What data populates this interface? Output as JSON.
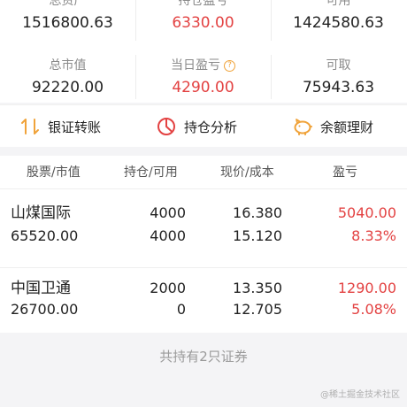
{
  "summary": {
    "total_assets": {
      "label": "总资产",
      "value": "1516800.63"
    },
    "position_pnl": {
      "label": "持仓盈亏",
      "value": "6330.00"
    },
    "available": {
      "label": "可用",
      "value": "1424580.63"
    },
    "market_value": {
      "label": "总市值",
      "value": "92220.00"
    },
    "daily_pnl": {
      "label": "当日盈亏",
      "value": "4290.00"
    },
    "withdrawable": {
      "label": "可取",
      "value": "75943.63"
    }
  },
  "actions": [
    {
      "label": "银证转账",
      "icon": "transfer-icon"
    },
    {
      "label": "持仓分析",
      "icon": "pie-chart-icon"
    },
    {
      "label": "余额理财",
      "icon": "piggy-bank-icon"
    }
  ],
  "holdings_header": {
    "col1": "股票/市值",
    "col2": "持仓/可用",
    "col3": "现价/成本",
    "col4": "盈亏"
  },
  "holdings": [
    {
      "name": "山煤国际",
      "market_value": "65520.00",
      "position": "4000",
      "available": "4000",
      "price": "16.380",
      "cost": "15.120",
      "pnl": "5040.00",
      "pnl_pct": "8.33%"
    },
    {
      "name": "中国卫通",
      "market_value": "26700.00",
      "position": "2000",
      "available": "0",
      "price": "13.350",
      "cost": "12.705",
      "pnl": "1290.00",
      "pnl_pct": "5.08%"
    }
  ],
  "footer": {
    "text": "共持有2只证券"
  },
  "watermark": "@稀土掘金技术社区",
  "colors": {
    "gain": "#e34242",
    "accent": "#f0a33a",
    "muted": "#8a8a8a"
  }
}
